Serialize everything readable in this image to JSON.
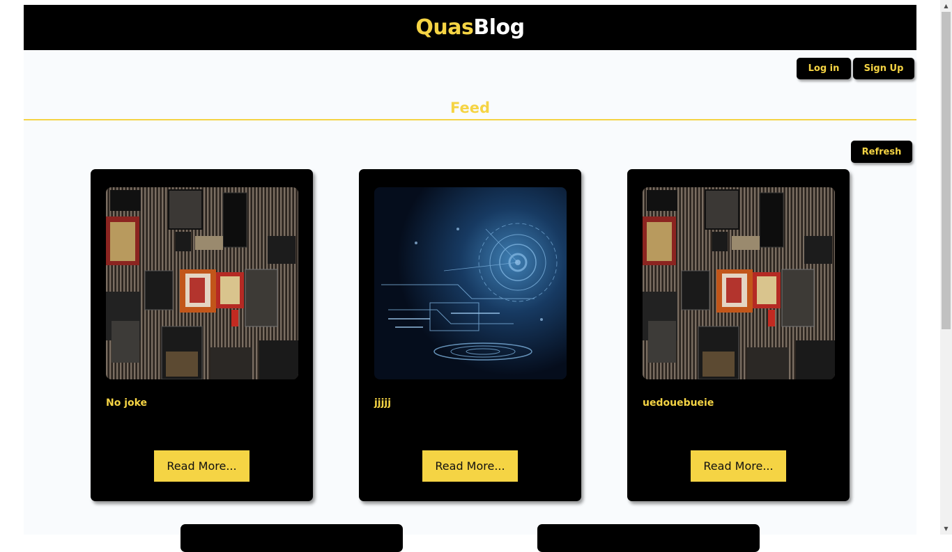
{
  "header": {
    "brand_part1": "Quas",
    "brand_part2": "Blog"
  },
  "auth": {
    "login_label": "Log in",
    "signup_label": "Sign Up"
  },
  "feed": {
    "title": "Feed",
    "refresh_label": "Refresh"
  },
  "posts": [
    {
      "title": "No joke",
      "read_more": "Read More...",
      "image": "music-wall-image"
    },
    {
      "title": "jjjjj",
      "read_more": "Read More...",
      "image": "tech-eye-image"
    },
    {
      "title": "uedouebueie",
      "read_more": "Read More...",
      "image": "music-wall-image"
    }
  ],
  "colors": {
    "accent": "#f5d444",
    "dark": "#000000",
    "page_bg": "#f9fbfd"
  }
}
